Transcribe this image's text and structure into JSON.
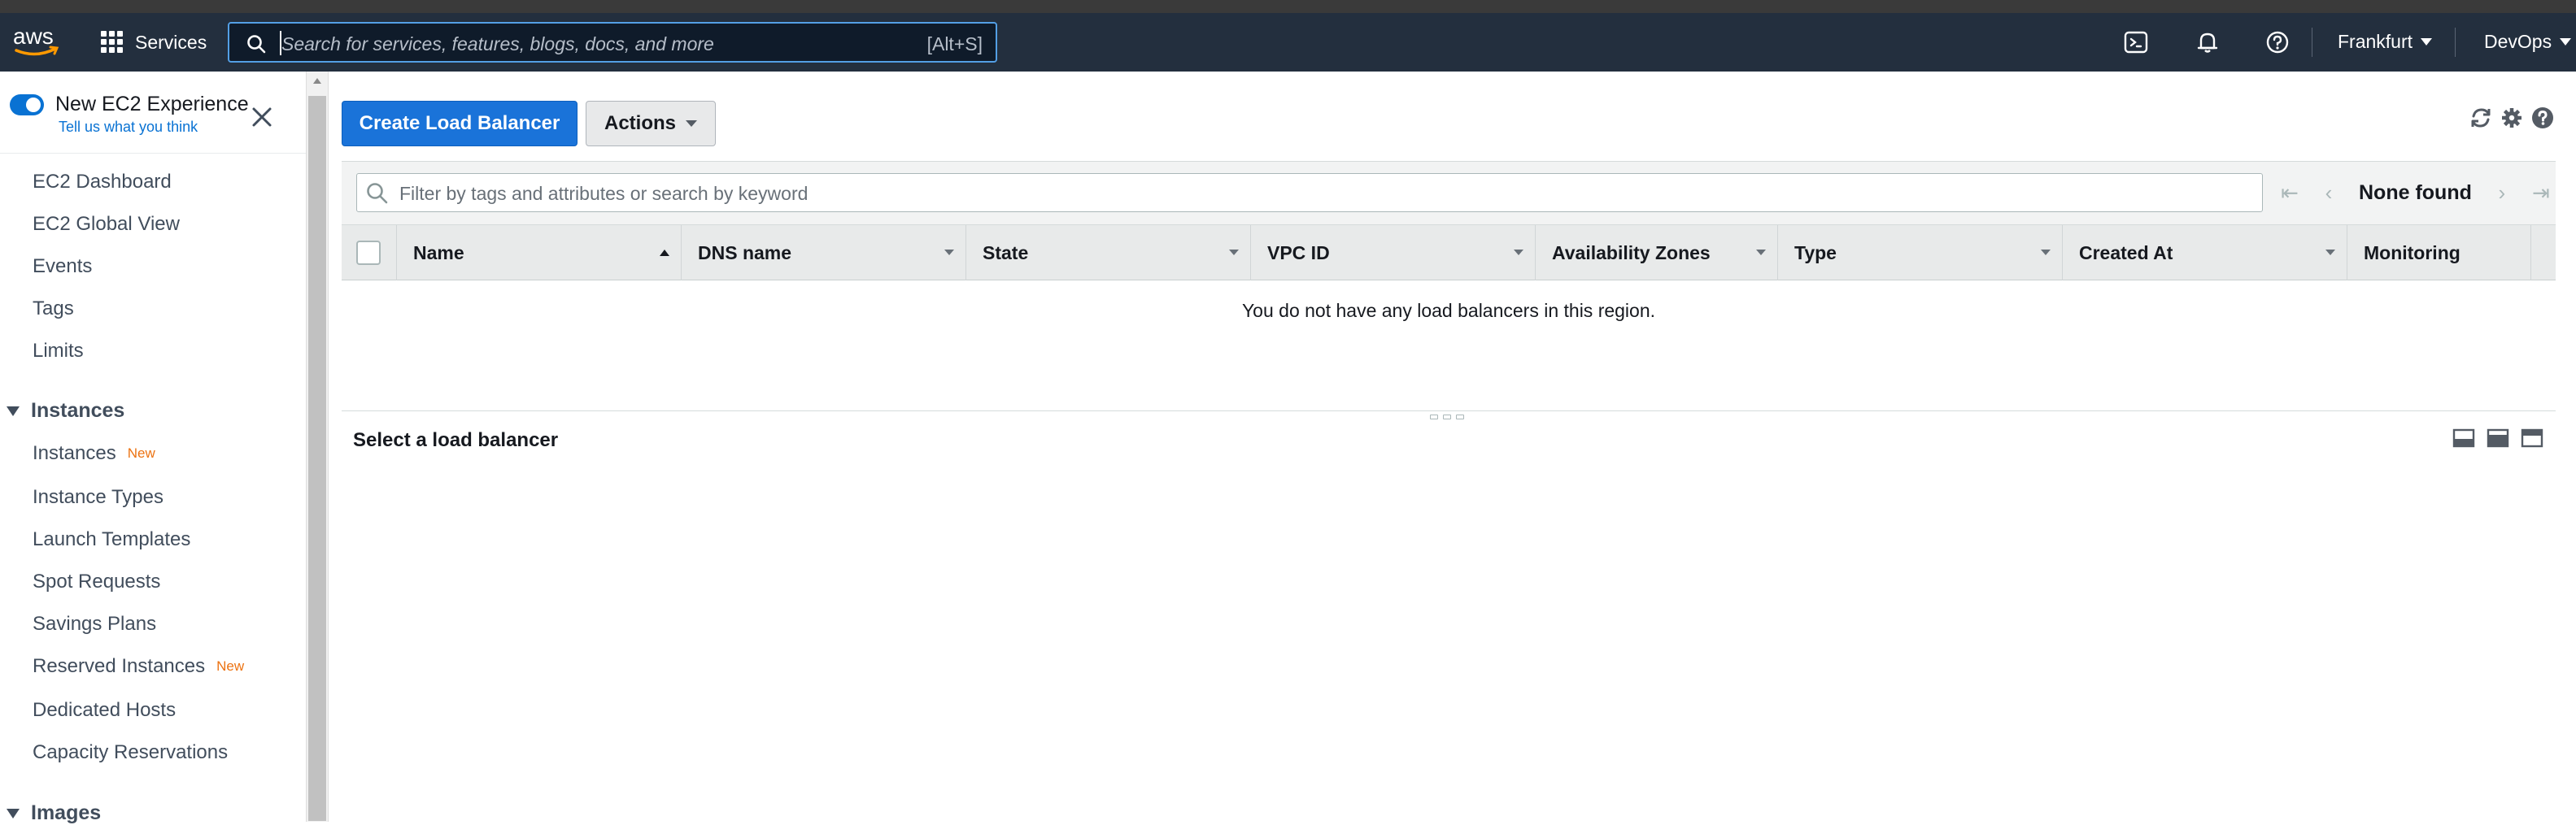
{
  "topnav": {
    "logo_text": "aws",
    "services_label": "Services",
    "search_placeholder": "Search for services, features, blogs, docs, and more",
    "search_shortcut": "[Alt+S]",
    "region": "Frankfurt",
    "account": "DevOps",
    "icons": [
      "cloudshell-icon",
      "bell-icon",
      "help-icon"
    ]
  },
  "sidebar": {
    "new_experience_label": "New EC2 Experience",
    "feedback_link": "Tell us what you think",
    "top_items": [
      "EC2 Dashboard",
      "EC2 Global View",
      "Events",
      "Tags",
      "Limits"
    ],
    "sections": [
      {
        "title": "Instances",
        "items": [
          {
            "label": "Instances",
            "badge": "New"
          },
          {
            "label": "Instance Types",
            "badge": ""
          },
          {
            "label": "Launch Templates",
            "badge": ""
          },
          {
            "label": "Spot Requests",
            "badge": ""
          },
          {
            "label": "Savings Plans",
            "badge": ""
          },
          {
            "label": "Reserved Instances",
            "badge": "New"
          },
          {
            "label": "Dedicated Hosts",
            "badge": ""
          },
          {
            "label": "Capacity Reservations",
            "badge": ""
          }
        ]
      },
      {
        "title": "Images",
        "items": []
      }
    ]
  },
  "toolbar": {
    "create_label": "Create Load Balancer",
    "actions_label": "Actions",
    "icons": [
      "refresh-icon",
      "settings-icon",
      "help-icon"
    ]
  },
  "filter": {
    "placeholder": "Filter by tags and attributes or search by keyword",
    "pager_text": "None found"
  },
  "table": {
    "columns": [
      "Name",
      "DNS name",
      "State",
      "VPC ID",
      "Availability Zones",
      "Type",
      "Created At",
      "Monitoring"
    ],
    "sorted_column": "Name",
    "empty_message": "You do not have any load balancers in this region."
  },
  "details": {
    "title": "Select a load balancer"
  },
  "colors": {
    "nav_bg": "#232f3e",
    "primary_button": "#1a73d9",
    "toggle_on": "#0972d3",
    "badge_new": "#ec7211"
  }
}
